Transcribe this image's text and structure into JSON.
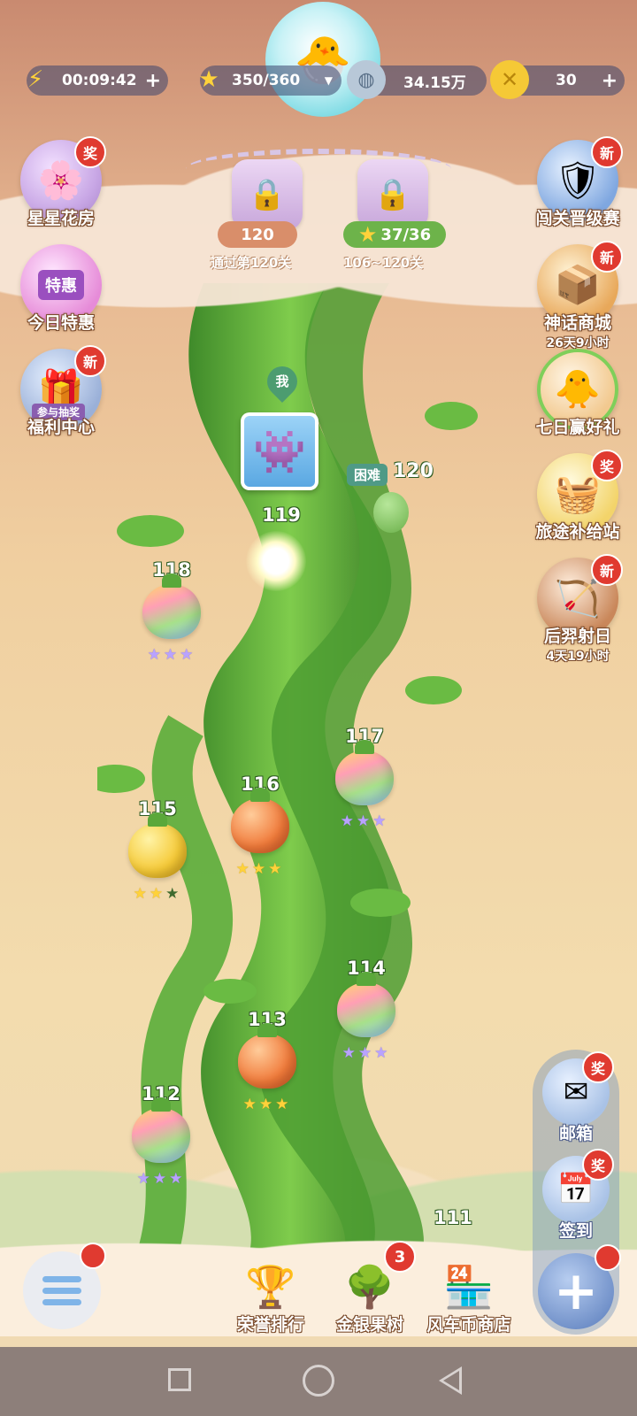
{
  "colors": {
    "vine": "#4f9f33",
    "badge": "#e03a30",
    "sky_top": "#c98a70",
    "sky_bottom": "#efd9b4"
  },
  "top_bar": {
    "energy_timer": "00:09:42",
    "stars": "350/360",
    "coins_silver": "34.15万",
    "coins_gold": "30",
    "energy_icon": "lightning-icon",
    "star_icon": "star-icon",
    "silver_icon": "silver-coin-icon",
    "gold_icon": "gold-coin-icon"
  },
  "locks": {
    "left": {
      "value": "120",
      "caption": "通过第120关"
    },
    "right": {
      "value": "37/36",
      "caption": "106~120关"
    }
  },
  "left_buttons": [
    {
      "label": "星星花房",
      "badge": "奖",
      "icon": "flower-icon"
    },
    {
      "label": "今日特惠",
      "inner": "特惠",
      "icon": "shop-icon"
    },
    {
      "label": "福利中心",
      "badge": "新",
      "ribbon": "参与抽奖",
      "icon": "gift-icon"
    }
  ],
  "right_buttons": [
    {
      "label": "闯关晋级赛",
      "badge": "新",
      "icon": "shield-icon"
    },
    {
      "label": "神话商城",
      "sub": "26天9小时",
      "badge": "新",
      "icon": "treasure-icon"
    },
    {
      "label": "七日赢好礼",
      "icon": "chick-icon"
    },
    {
      "label": "旅途补给站",
      "badge": "奖",
      "icon": "basket-icon"
    },
    {
      "label": "后羿射日",
      "sub": "4天19小时",
      "badge": "新",
      "icon": "archer-icon"
    }
  ],
  "map": {
    "me_label": "我",
    "hard_label": "困难",
    "hard_level": "120",
    "current_level": "119",
    "levels": [
      {
        "num": "118",
        "type": "rainbow",
        "stars": "rainbow3"
      },
      {
        "num": "117",
        "type": "rainbow",
        "stars": "rainbow3"
      },
      {
        "num": "116",
        "type": "orange",
        "stars": "gold3"
      },
      {
        "num": "115",
        "type": "gold",
        "stars": "gold2"
      },
      {
        "num": "114",
        "type": "rainbow",
        "stars": "rainbow3"
      },
      {
        "num": "113",
        "type": "orange",
        "stars": "gold3"
      },
      {
        "num": "112",
        "type": "rainbow",
        "stars": "rainbow3"
      },
      {
        "num": "111",
        "type": "hidden",
        "stars": ""
      }
    ]
  },
  "dock": {
    "mail_label": "邮箱",
    "mail_badge": "奖",
    "signin_label": "签到",
    "signin_badge": "奖",
    "plus_symbol": "+"
  },
  "bottom_nav": {
    "rank_label": "荣誉排行",
    "tree_label": "金银果树",
    "tree_badge": "3",
    "shop_label": "风车币商店"
  }
}
